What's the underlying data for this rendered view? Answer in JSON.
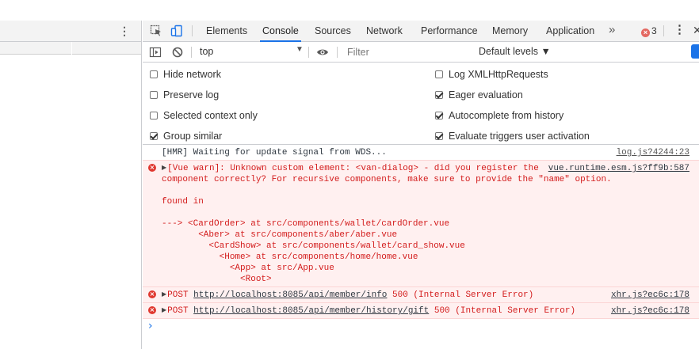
{
  "tabs": [
    {
      "label": "Elements",
      "active": false
    },
    {
      "label": "Console",
      "active": true
    },
    {
      "label": "Sources",
      "active": false
    },
    {
      "label": "Network",
      "active": false
    },
    {
      "label": "Performance",
      "active": false
    },
    {
      "label": "Memory",
      "active": false
    },
    {
      "label": "Application",
      "active": false
    }
  ],
  "more_tabs_icon": "»",
  "error_count": "3",
  "kebab_icon": "⋮",
  "close_icon": "✕",
  "console_toolbar": {
    "context": "top",
    "filter_placeholder": "Filter",
    "levels": "Default levels ▼"
  },
  "settings": {
    "left": [
      {
        "label": "Hide network",
        "checked": false
      },
      {
        "label": "Preserve log",
        "checked": false
      },
      {
        "label": "Selected context only",
        "checked": false
      },
      {
        "label": "Group similar",
        "checked": true
      }
    ],
    "right": [
      {
        "label": "Log XMLHttpRequests",
        "checked": false
      },
      {
        "label": "Eager evaluation",
        "checked": true
      },
      {
        "label": "Autocomplete from history",
        "checked": true
      },
      {
        "label": "Evaluate triggers user activation",
        "checked": true
      }
    ]
  },
  "messages": {
    "hmr": {
      "text": "[HMR] Waiting for update signal from WDS...",
      "source": "log.js?4244:23"
    },
    "vue": {
      "line1": "[Vue warn]: Unknown custom element: <van-dialog> - did you register the",
      "line2": "component correctly? For recursive components, make sure to provide the \"name\" option.",
      "source": "vue.runtime.esm.js?ff9b:587",
      "found": "found in",
      "trace": [
        "---> <CardOrder> at src/components/wallet/cardOrder.vue",
        "       <Aber> at src/components/aber/aber.vue",
        "         <CardShow> at src/components/wallet/card_show.vue",
        "           <Home> at src/components/home/home.vue",
        "             <App> at src/App.vue",
        "               <Root>"
      ]
    },
    "post1": {
      "method": "POST",
      "url": "http://localhost:8085/api/member/info",
      "status": "500 (Internal Server Error)",
      "source": "xhr.js?ec6c:178"
    },
    "post2": {
      "method": "POST",
      "url": "http://localhost:8085/api/member/history/gift",
      "status": "500 (Internal Server Error)",
      "source": "xhr.js?ec6c:178"
    }
  },
  "prompt_symbol": "›",
  "colors": {
    "accent": "#1a73e8",
    "error": "#d31c1c",
    "error_bg": "#fff0f0"
  }
}
